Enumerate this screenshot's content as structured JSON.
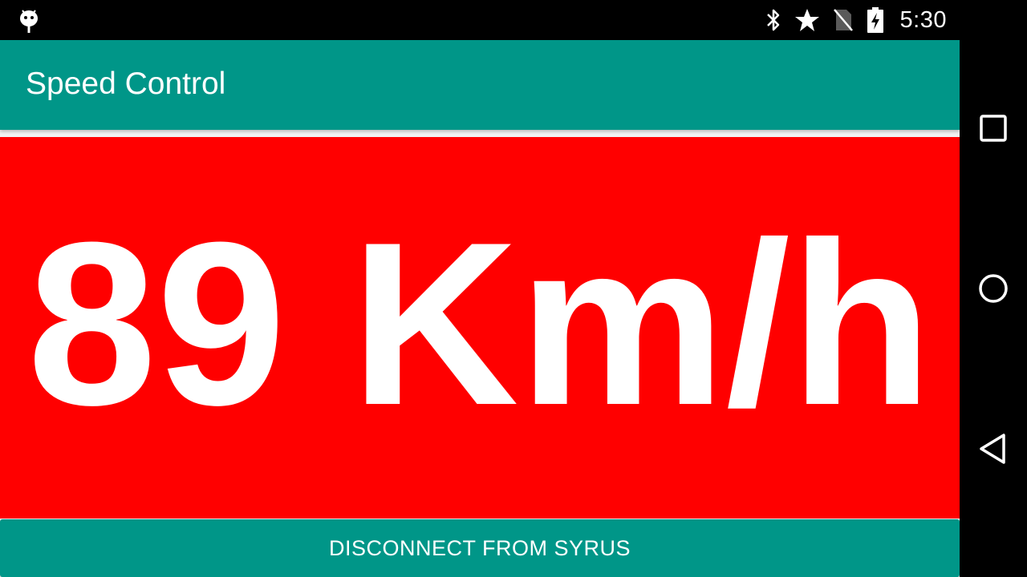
{
  "status_bar": {
    "time": "5:30",
    "icons": [
      "android-debug-icon",
      "bluetooth-icon",
      "star-icon",
      "no-sim-icon",
      "battery-charging-icon"
    ]
  },
  "toolbar": {
    "title": "Speed Control"
  },
  "speed": {
    "value": "89",
    "unit": "Km/h",
    "display": "89 Km/h",
    "background_color": "#ff0000"
  },
  "actions": {
    "disconnect_label": "DISCONNECT FROM SYRUS"
  },
  "nav_bar": {
    "buttons": [
      "recents-icon",
      "home-icon",
      "back-icon"
    ]
  },
  "colors": {
    "primary": "#009688",
    "alert": "#ff0000",
    "text_on_primary": "#ffffff"
  }
}
